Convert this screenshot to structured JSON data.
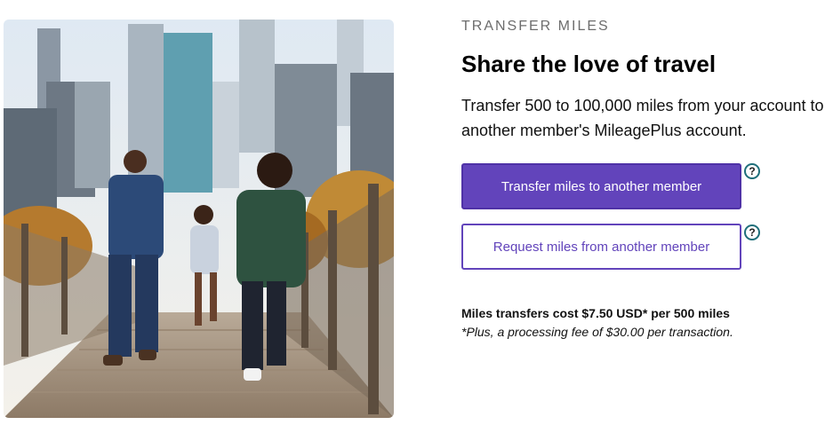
{
  "photo": {
    "description_icon": "family-walking-on-bridge-photo"
  },
  "header": {
    "eyebrow": "TRANSFER MILES",
    "title": "Share the love of travel"
  },
  "description": "Transfer 500 to 100,000 miles from your account to another member's MileagePlus account.",
  "actions": {
    "transfer_label": "Transfer miles to another member",
    "request_label": "Request miles from another member",
    "help_glyph": "?"
  },
  "pricing": {
    "cost_text": "Miles transfers cost $7.50 USD* per 500 miles",
    "fee_text": "*Plus, a processing fee of $30.00 per transaction."
  },
  "colors": {
    "brand_purple": "#6244bb",
    "help_ring": "#1f6f7a"
  }
}
